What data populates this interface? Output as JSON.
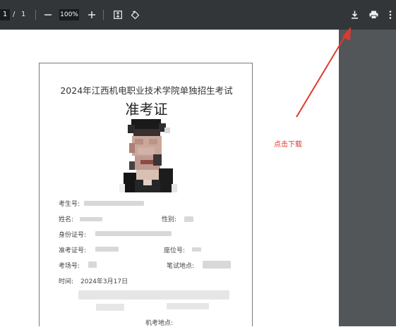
{
  "toolbar": {
    "page_current": "1",
    "page_separator": "/",
    "page_total": "1",
    "zoom_out_icon": "minus-icon",
    "zoom_value": "100%",
    "zoom_in_icon": "plus-icon",
    "fit_icon": "fit-to-page-icon",
    "rotate_icon": "rotate-icon",
    "download_icon": "download-icon",
    "print_icon": "print-icon",
    "more_icon": "more-vertical-icon"
  },
  "document": {
    "title": "2024年江西机电职业技术学院单独招生考试",
    "subtitle": "准考证",
    "fields": {
      "exam_no_label": "考生号:",
      "name_label": "姓名:",
      "gender_label": "性别:",
      "id_label": "身份证号:",
      "ticket_label": "准考证号:",
      "seat_label": "座位号:",
      "room_label": "考场号:",
      "written_site_label": "笔试地点:",
      "time_label": "时间:",
      "time_value": "2024年3月17日",
      "computer_site_label": "机考地点:"
    }
  },
  "annotation": {
    "text": "点击下载",
    "color": "#e0382c"
  },
  "colors": {
    "toolbar_bg": "#323639",
    "side_panel": "#535659"
  }
}
